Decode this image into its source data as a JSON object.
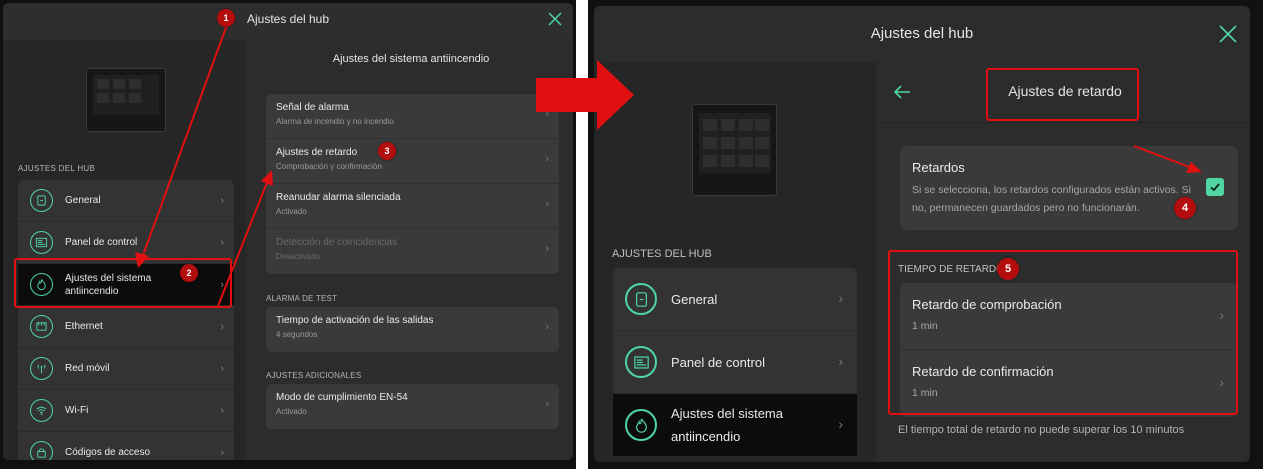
{
  "left": {
    "title": "Ajustes del hub",
    "section_label": "AJUSTES DEL HUB",
    "sidebar": [
      {
        "label": "General",
        "icon": "hub-icon"
      },
      {
        "label": "Panel de control",
        "icon": "panel-icon"
      },
      {
        "label": "Ajustes del sistema antiincendio",
        "icon": "fire-icon"
      },
      {
        "label": "Ethernet",
        "icon": "ethernet-icon"
      },
      {
        "label": "Red móvil",
        "icon": "antenna-icon"
      },
      {
        "label": "Wi-Fi",
        "icon": "wifi-icon"
      },
      {
        "label": "Códigos de acceso",
        "icon": "lock-icon"
      }
    ],
    "main_title": "Ajustes del sistema antiincendio",
    "rows": [
      {
        "title": "Señal de alarma",
        "subtitle": "Alarma de incendio y no incendio"
      },
      {
        "title": "Ajustes de retardo",
        "subtitle": "Comprobación y confirmación"
      },
      {
        "title": "Reanudar alarma silenciada",
        "subtitle": "Activado"
      },
      {
        "title": "Detección de coincidencias",
        "subtitle": "Desactivado"
      }
    ],
    "test_section": "ALARMA DE TEST",
    "test_row": {
      "title": "Tiempo de activación de las salidas",
      "subtitle": "4 segundos"
    },
    "extra_section": "AJUSTES ADICIONALES",
    "extra_row": {
      "title": "Modo de cumplimiento EN-54",
      "subtitle": "Activado"
    }
  },
  "right": {
    "title": "Ajustes del hub",
    "section_label": "AJUSTES DEL HUB",
    "sidebar": [
      {
        "label": "General",
        "icon": "hub-icon"
      },
      {
        "label": "Panel de control",
        "icon": "panel-icon"
      },
      {
        "label": "Ajustes del sistema antiincendio",
        "icon": "fire-icon"
      }
    ],
    "main_title": "Ajustes de retardo",
    "delays": {
      "title": "Retardos",
      "description": "Si se selecciona, los retardos configurados están activos. Si no, permanecen guardados pero no funcionarán.",
      "checked": true
    },
    "tiempo_section": "TIEMPO DE RETARDO",
    "tiempo_rows": [
      {
        "title": "Retardo de comprobación",
        "subtitle": "1 min"
      },
      {
        "title": "Retardo de confirmación",
        "subtitle": "1 min"
      }
    ],
    "footer": "El tiempo total de retardo no puede superar los 10 minutos"
  },
  "badges": [
    "1",
    "2",
    "3",
    "4",
    "5"
  ],
  "colors": {
    "accent": "#4fd6a2",
    "annotation": "#e01010",
    "badge": "#b40d0d"
  }
}
